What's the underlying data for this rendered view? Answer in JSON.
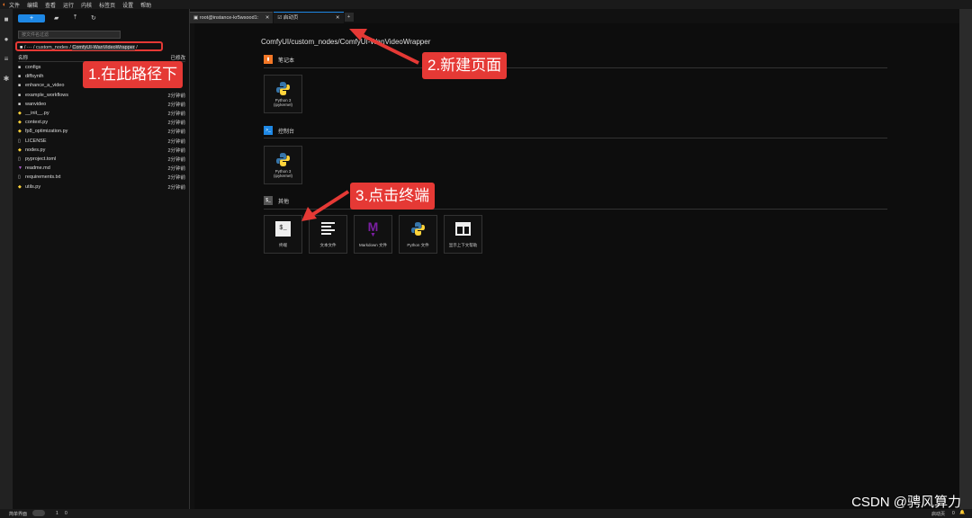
{
  "menubar": {
    "items": [
      "文件",
      "编辑",
      "查看",
      "运行",
      "内核",
      "标签页",
      "设置",
      "帮助"
    ]
  },
  "sidebar": {
    "new_button": "+",
    "search_placeholder": "按文件名过滤",
    "breadcrumb": {
      "root": "/",
      "ellipsis": "···",
      "part1": "custom_nodes",
      "current": "ComfyUI-WanVideoWrapper"
    },
    "header": {
      "name": "名称",
      "modified": "已修改"
    },
    "files": [
      {
        "name": "configs",
        "type": "folder",
        "time": ""
      },
      {
        "name": "diffsynth",
        "type": "folder",
        "time": ""
      },
      {
        "name": "enhance_a_video",
        "type": "folder",
        "time": ""
      },
      {
        "name": "example_workflows",
        "type": "folder",
        "time": "2分钟前"
      },
      {
        "name": "wanvideo",
        "type": "folder",
        "time": "2分钟前"
      },
      {
        "name": "__init__.py",
        "type": "py",
        "time": "2分钟前"
      },
      {
        "name": "context.py",
        "type": "py",
        "time": "2分钟前"
      },
      {
        "name": "fp8_optimization.py",
        "type": "py",
        "time": "2分钟前"
      },
      {
        "name": "LICENSE",
        "type": "file",
        "time": "2分钟前"
      },
      {
        "name": "nodes.py",
        "type": "py",
        "time": "2分钟前"
      },
      {
        "name": "pyproject.toml",
        "type": "file",
        "time": "2分钟前"
      },
      {
        "name": "readme.md",
        "type": "md",
        "time": "2分钟前"
      },
      {
        "name": "requirements.txt",
        "type": "file",
        "time": "2分钟前"
      },
      {
        "name": "utils.py",
        "type": "py",
        "time": "2分钟前"
      }
    ]
  },
  "tabs": [
    {
      "label": "root@instance-kr5wsood1:",
      "active": false
    },
    {
      "label": "启动页",
      "active": true
    }
  ],
  "launcher": {
    "path": "ComfyUI/custom_nodes/ComfyUI-WanVideoWrapper",
    "sections": {
      "notebook": "笔记本",
      "console": "控制台",
      "other": "其他"
    },
    "kernel_label": "Python 3\n(ipykernel)",
    "other_cards": [
      "终端",
      "文本文件",
      "Markdown 文件",
      "Python 文件",
      "显示上下文帮助"
    ]
  },
  "annotations": {
    "a1": "1.在此路径下",
    "a2": "2.新建页面",
    "a3": "3.点击终端"
  },
  "statusbar": {
    "simple_mode": "简单界面",
    "count1": "1",
    "count2": "0",
    "mode": "启动页",
    "count3": "0"
  },
  "watermark": "CSDN @骋风算力",
  "colors": {
    "accent": "#1e88e5",
    "annotation": "#e53935",
    "python_blue": "#3776ab",
    "python_yellow": "#ffd43b",
    "markdown_purple": "#7b1fa2"
  }
}
